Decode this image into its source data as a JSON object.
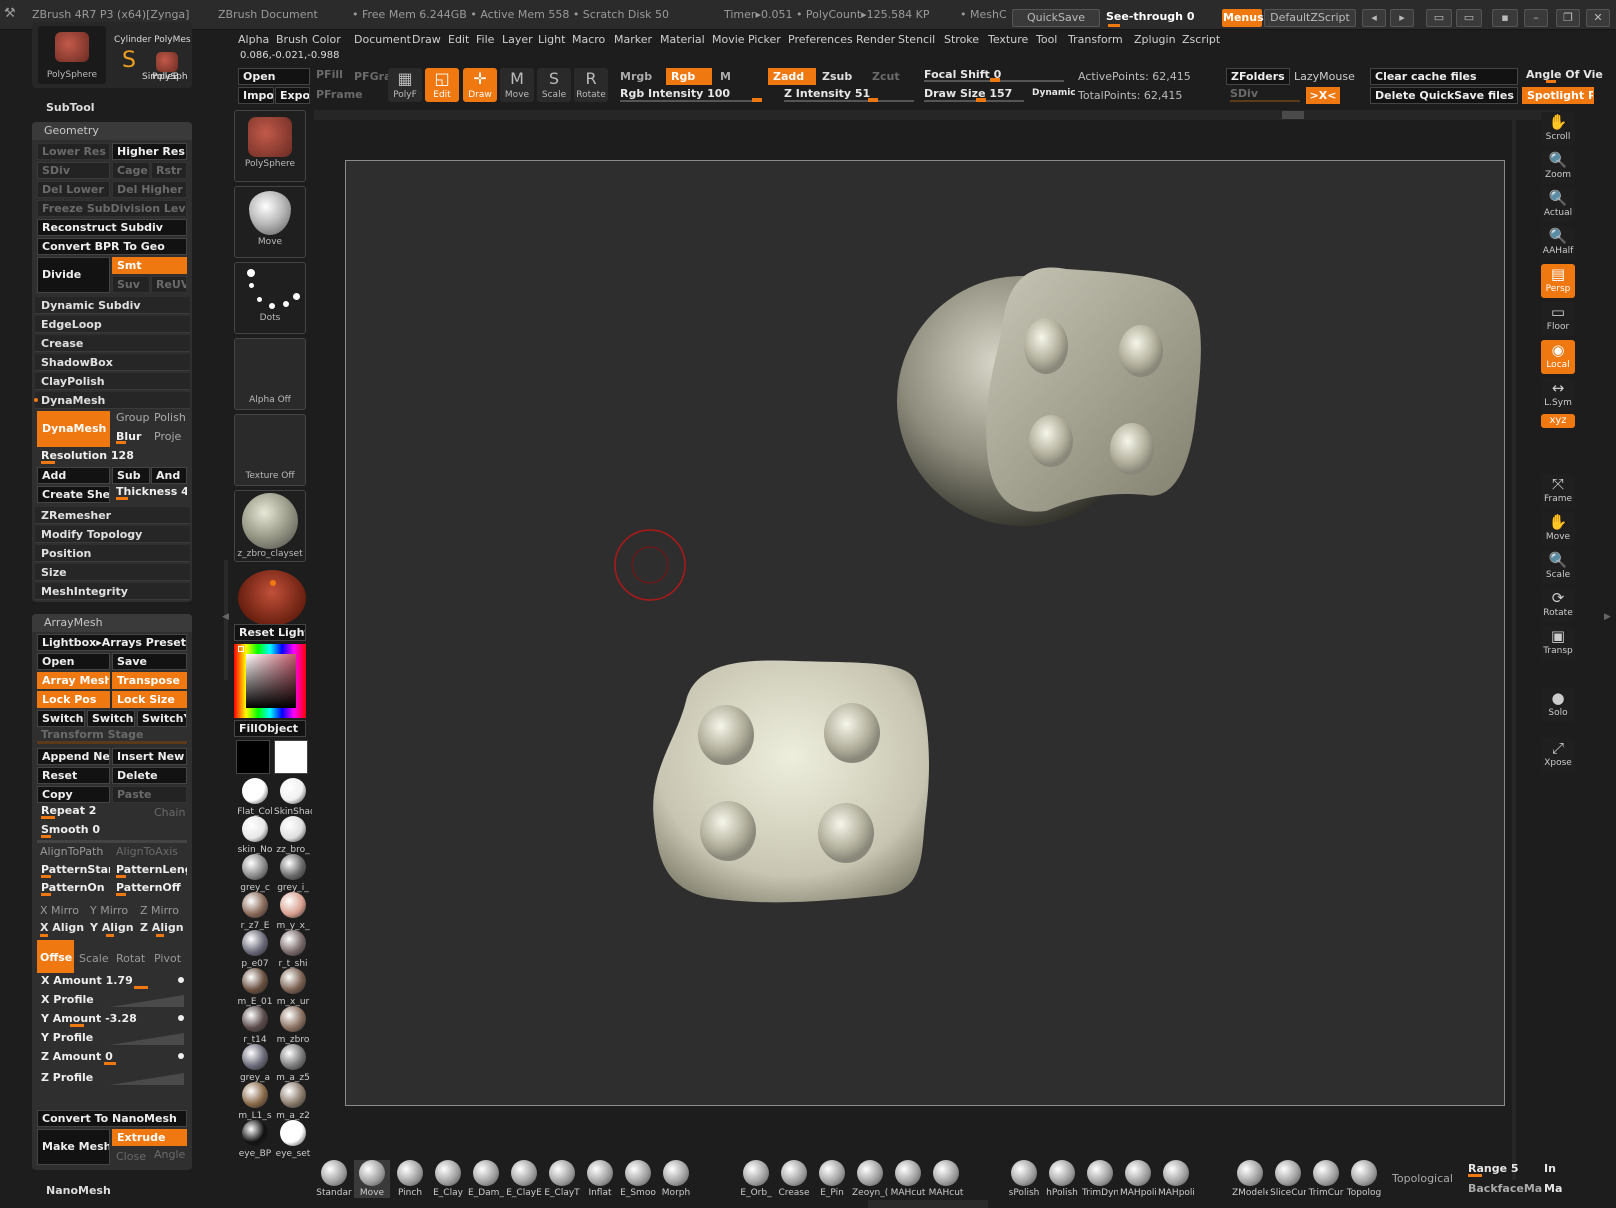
{
  "titlebar": {
    "app": "ZBrush 4R7 P3 (x64)[Zynga]",
    "doc": "ZBrush Document",
    "mem": "• Free Mem 6.244GB • Active Mem 558 • Scratch Disk 50",
    "timer": "Timer▸0.051 • PolyCount▸125.584 KP",
    "mesh": "• MeshC",
    "quicksave": "QuickSave",
    "see_through": "See-through  0",
    "menus": "Menus",
    "script": "DefaultZScript"
  },
  "menubar": [
    "Alpha",
    "Brush",
    "Color",
    "Document",
    "Draw",
    "Edit",
    "File",
    "Layer",
    "Light",
    "Macro",
    "Marker",
    "Material",
    "Movie",
    "Picker",
    "Preferences",
    "Render",
    "Stencil",
    "Stroke",
    "Texture",
    "Tool",
    "Transform",
    "Zplugin",
    "Zscript"
  ],
  "coords": "0.086,-0.021,-0.988",
  "toolbar": {
    "open": "Open",
    "import": "Impo",
    "export": "Expor",
    "pfill": "PFill",
    "pfgrad": "PFGra",
    "pframe": "PFrame",
    "polyf": "PolyF",
    "edit": "Edit",
    "draw": "Draw",
    "move": "Move",
    "scale": "Scale",
    "rotate": "Rotate",
    "mrgb": "Mrgb",
    "rgb": "Rgb",
    "m": "M",
    "zadd": "Zadd",
    "zsub": "Zsub",
    "zcut": "Zcut",
    "rgb_intensity": "Rgb Intensity 100",
    "z_intensity": "Z Intensity 51",
    "focal_shift": "Focal Shift 0",
    "draw_size": "Draw Size 157",
    "dynamic": "Dynamic",
    "active_points": "ActivePoints: 62,415",
    "total_points": "TotalPoints: 62,415",
    "zfolders": "ZFolders",
    "lazymouse": "LazyMouse",
    "sdiv": "SDiv",
    "clear_cache": "Clear cache files",
    "delete_quicksave": "Delete QuickSave files",
    "angle_of_view": "Angle Of Vie",
    "spotlight": "Spotlight Pro"
  },
  "left_top": {
    "polysphere": "PolySphere",
    "cylinder": "Cylinder PolyMes",
    "simplebrush": "SimpleB",
    "polysph2": "PolySph",
    "subtool": "SubTool"
  },
  "geometry": {
    "title": "Geometry",
    "lower_res": "Lower Res",
    "higher_res": "Higher Res",
    "sdiv": "SDiv",
    "cage": "Cage",
    "rstr": "Rstr",
    "del_lower": "Del Lower",
    "del_higher": "Del Higher",
    "freeze": "Freeze SubDivision Levels",
    "reconstruct": "Reconstruct Subdiv",
    "convert_bpr": "Convert BPR To Geo",
    "divide": "Divide",
    "smt": "Smt",
    "suv": "Suv",
    "reuv": "ReUV",
    "items": [
      "Dynamic Subdiv",
      "EdgeLoop",
      "Crease",
      "ShadowBox",
      "ClayPolish",
      "DynaMesh"
    ],
    "dynamesh_btn": "DynaMesh",
    "group": "Group",
    "polish": "Polish",
    "blur": "Blur",
    "proje": "Proje",
    "resolution": "Resolution 128",
    "add": "Add",
    "sub": "Sub",
    "and": "And",
    "create_shell": "Create Shell",
    "thickness": "Thickness 4",
    "items2": [
      "ZRemesher",
      "Modify Topology",
      "Position",
      "Size",
      "MeshIntegrity"
    ]
  },
  "arraymesh": {
    "title": "ArrayMesh",
    "lightbox": "Lightbox▸Arrays Preset",
    "open": "Open",
    "save": "Save",
    "array_mesh": "Array Mesh",
    "transpose": "Transpose",
    "lock_pos": "Lock Pos",
    "lock_size": "Lock Size",
    "switchx": "SwitchX",
    "switchxy": "SwitchX",
    "switchy": "SwitchY",
    "transform_stage": "Transform Stage",
    "append_new": "Append New",
    "insert_new": "Insert New",
    "reset": "Reset",
    "delete": "Delete",
    "copy": "Copy",
    "paste": "Paste",
    "repeat": "Repeat 2",
    "chain": "Chain",
    "smooth": "Smooth 0",
    "align_path": "AlignToPath",
    "align_axis": "AlignToAxis",
    "pattern_start": "PatternStart",
    "pattern_length": "PatternLeng",
    "pattern_on": "PatternOn",
    "pattern_off": "PatternOff",
    "x_mirror": "X Mirro",
    "y_mirror": "Y Mirro",
    "z_mirror": "Z Mirro",
    "x_align": "X Align",
    "y_align": "Y Align",
    "z_align": "Z Align",
    "offset": "Offse",
    "scale": "Scale",
    "rotate": "Rotat",
    "pivot": "Pivot",
    "x_amount": "X Amount 1.79",
    "x_profile": "X Profile",
    "y_amount": "Y Amount -3.28",
    "y_profile": "Y Profile",
    "z_amount": "Z Amount 0",
    "z_profile": "Z Profile",
    "convert_nano": "Convert To NanoMesh",
    "make_mesh": "Make Mesh",
    "extrude": "Extrude",
    "close": "Close",
    "angle": "Angle",
    "nanomesh": "NanoMesh"
  },
  "palette": {
    "polysphere": "PolySphere",
    "move": "Move",
    "dots": "Dots",
    "alpha_off": "Alpha  Off",
    "texture_off": "Texture  Off",
    "material": "z_zbro_clayset",
    "reset_light": "Reset Light",
    "fill_object": "FillObject",
    "materials": [
      [
        "Flat_Col",
        "SkinShad"
      ],
      [
        "skin_No",
        "zz_bro_"
      ],
      [
        "grey_c",
        "grey_i_"
      ],
      [
        "r_z7_E",
        "m_y_x_"
      ],
      [
        "p_e07",
        "r_t_shi"
      ],
      [
        "m_E_01",
        "m_x_ur"
      ],
      [
        "r_t14",
        "m_zbro"
      ],
      [
        "grey_a",
        "m_a_z5"
      ],
      [
        "m_L1_s",
        "m_a_z2"
      ],
      [
        "eye_BP",
        "eye_set"
      ]
    ]
  },
  "right_shelf": [
    "Scroll",
    "Zoom",
    "Actual",
    "AAHalf",
    "Persp",
    "Floor",
    "Local",
    "L.Sym",
    "XYZ",
    "Frame",
    "Move",
    "Scale",
    "Rotate",
    "Transp",
    "Solo",
    "Xpose"
  ],
  "bottom_brushes": [
    "Standar",
    "Move",
    "Pinch",
    "E_Clay",
    "E_Dam_",
    "E_ClayE",
    "E_ClayT",
    "Inflat",
    "E_Smoo",
    "Morph",
    "E_Orb_",
    "Crease",
    "E_Pin",
    "Zeoyn_(",
    "MAHcut",
    "MAHcut",
    "sPolish",
    "hPolish",
    "TrimDyn",
    "MAHpoli:",
    "MAHpoli:",
    "ZModele",
    "SliceCur",
    "TrimCur",
    "Topolog"
  ],
  "bottom_right": {
    "topological": "Topological",
    "range": "Range 5",
    "in": "In",
    "backface": "BackfaceMa",
    "ma": "Ma"
  },
  "colors": {
    "accent": "#f07810",
    "canvas": "#2e2e2e"
  }
}
